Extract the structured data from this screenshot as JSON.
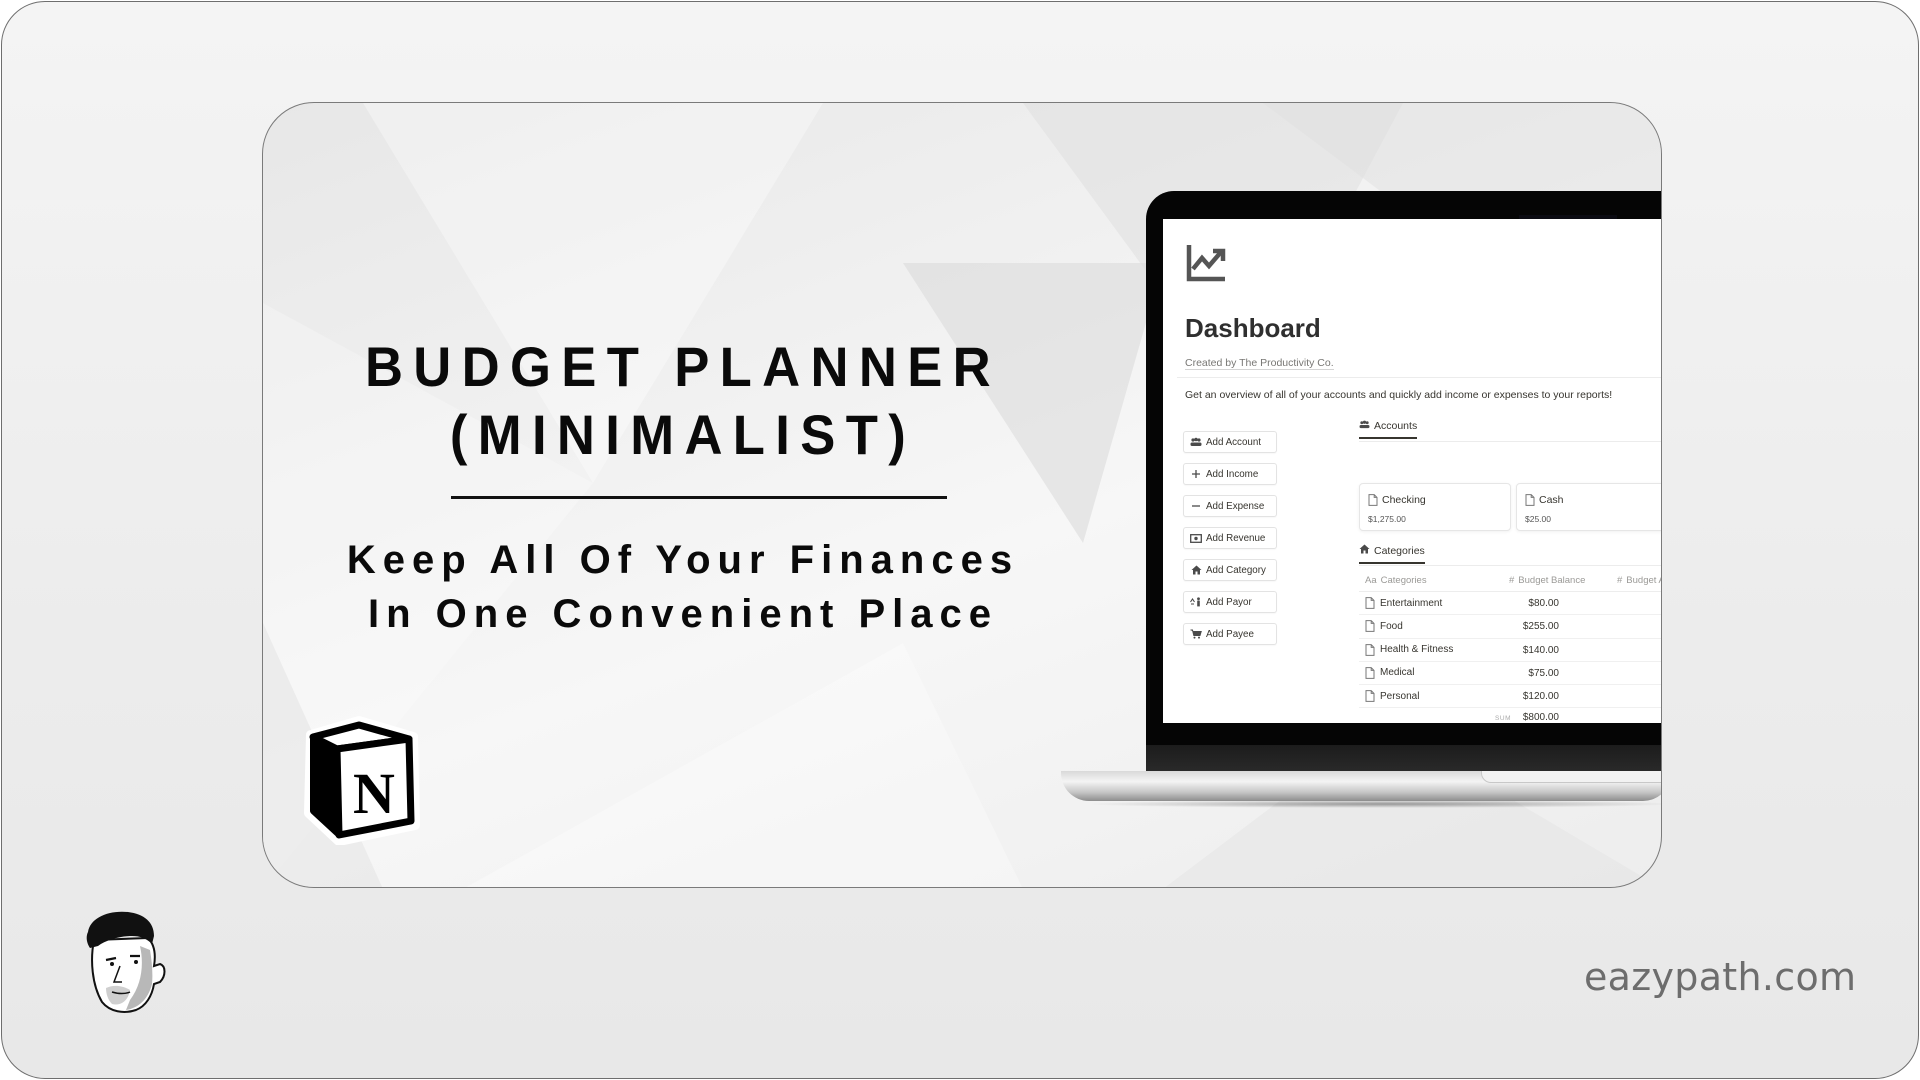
{
  "hero": {
    "title_lines": [
      "BUDGET PLANNER",
      "(MINIMALIST)"
    ],
    "subtitle_lines": [
      "Keep All Of Your Finances",
      "In One Convenient Place"
    ]
  },
  "logos": {
    "notion": "notion-logo-icon",
    "notion_letter": "N",
    "avatar": "cartoon-avatar-icon"
  },
  "footer": {
    "site_url": "eazypath.com"
  },
  "laptop_screen": {
    "page_icon": "trending-up-chart-icon",
    "title": "Dashboard",
    "created_by": "Created by The Productivity Co.",
    "description": "Get an overview of all of your accounts and quickly add income or expenses to your reports!",
    "buttons": [
      {
        "label": "Add Account",
        "icon": "people-icon"
      },
      {
        "label": "Add Income",
        "icon": "plus-icon"
      },
      {
        "label": "Add Expense",
        "icon": "minus-icon"
      },
      {
        "label": "Add Revenue",
        "icon": "money-bill-icon"
      },
      {
        "label": "Add Category",
        "icon": "home-icon"
      },
      {
        "label": "Add Payor",
        "icon": "payor-icon"
      },
      {
        "label": "Add Payee",
        "icon": "cart-icon"
      }
    ],
    "accounts": {
      "tab_label": "Accounts",
      "tab_icon": "people-icon",
      "items": [
        {
          "name": "Checking",
          "balance": "$1,275.00"
        },
        {
          "name": "Cash",
          "balance": "$25.00"
        }
      ]
    },
    "categories": {
      "tab_label": "Categories",
      "tab_icon": "home-icon",
      "columns": [
        {
          "prefix": "Aa",
          "label": "Categories"
        },
        {
          "prefix": "#",
          "label": "Budget Balance"
        },
        {
          "prefix": "#",
          "label": "Budget A"
        }
      ],
      "rows": [
        {
          "name": "Entertainment",
          "budget_balance": "$80.00"
        },
        {
          "name": "Food",
          "budget_balance": "$255.00"
        },
        {
          "name": "Health & Fitness",
          "budget_balance": "$140.00"
        },
        {
          "name": "Medical",
          "budget_balance": "$75.00"
        },
        {
          "name": "Personal",
          "budget_balance": "$120.00"
        }
      ],
      "sum_label": "SUM",
      "sum_value": "$800.00"
    }
  }
}
